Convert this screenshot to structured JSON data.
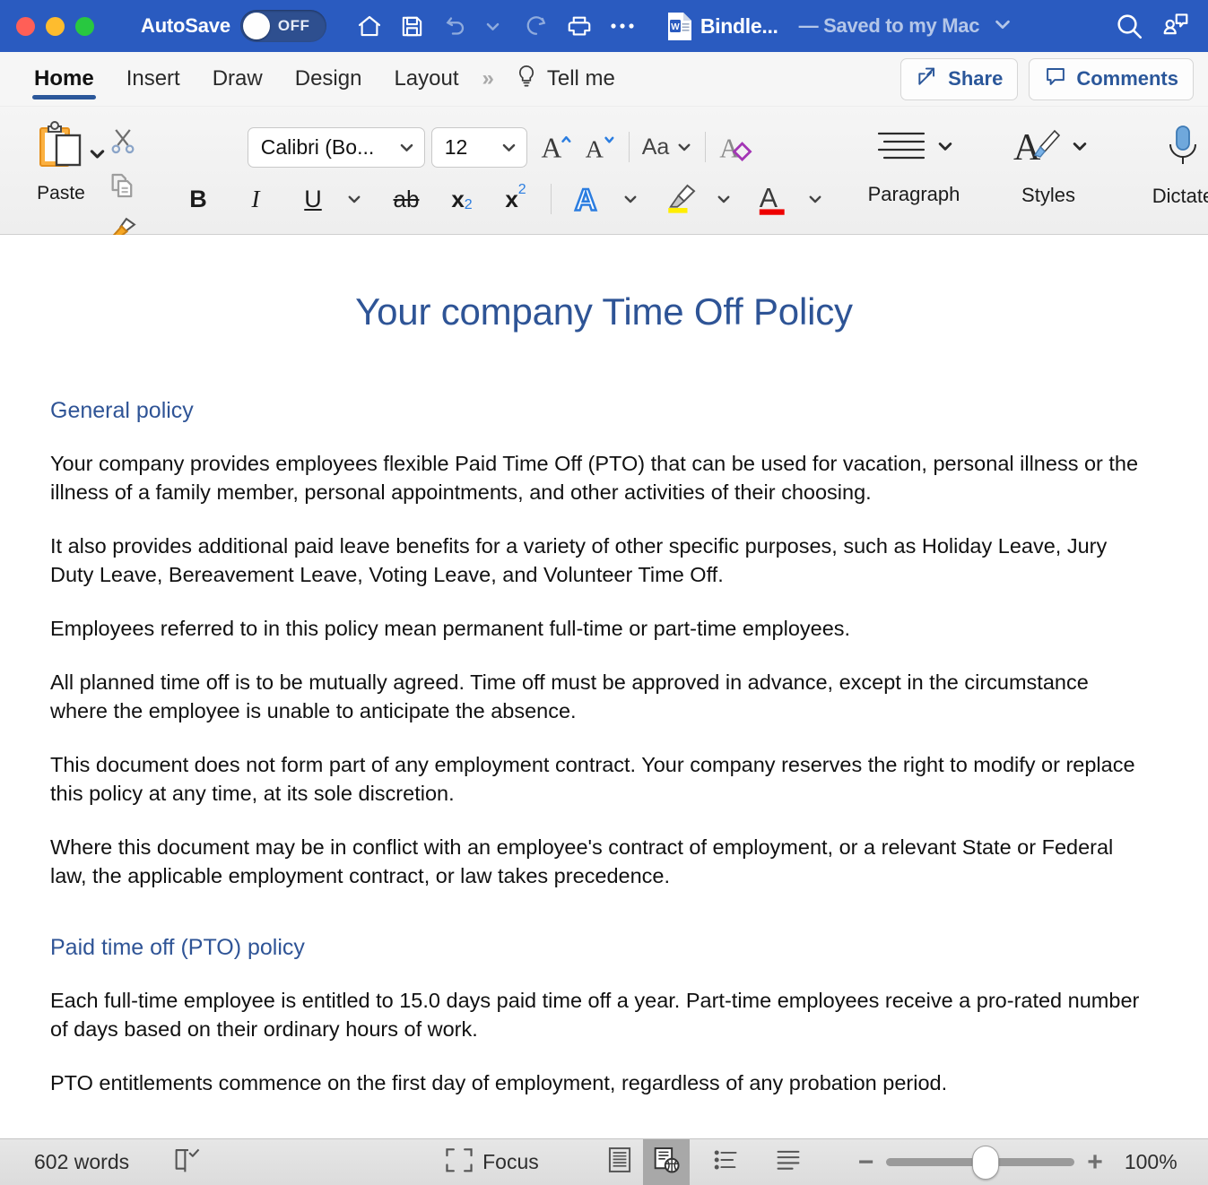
{
  "titlebar": {
    "autosave_label": "AutoSave",
    "autosave_state": "OFF",
    "document_name": "Bindle...",
    "saved_state": "— Saved to my Mac",
    "quick_access": [
      {
        "name": "home-icon",
        "label": "Home"
      },
      {
        "name": "save-icon",
        "label": "Save"
      },
      {
        "name": "undo-icon",
        "label": "Undo"
      },
      {
        "name": "redo-icon",
        "label": "Redo"
      },
      {
        "name": "print-icon",
        "label": "Print"
      },
      {
        "name": "more-icon",
        "label": "More"
      }
    ],
    "search_label": "Search",
    "collaborate_label": "Collaborate"
  },
  "ribbon_tabs": {
    "tabs": [
      {
        "label": "Home",
        "active": true
      },
      {
        "label": "Insert",
        "active": false
      },
      {
        "label": "Draw",
        "active": false
      },
      {
        "label": "Design",
        "active": false
      },
      {
        "label": "Layout",
        "active": false
      }
    ],
    "overflow_label": "»",
    "tellme_label": "Tell me",
    "share_label": "Share",
    "comments_label": "Comments"
  },
  "ribbon": {
    "paste_label": "Paste",
    "cut_label": "Cut",
    "copy_label": "Copy",
    "format_painter_label": "Format Painter",
    "font_name": "Calibri (Bo...",
    "font_size": "12",
    "grow_font_label": "Grow Font",
    "shrink_font_label": "Shrink Font",
    "change_case_label": "Aa",
    "clear_formatting_label": "Clear Formatting",
    "bold_label": "B",
    "italic_label": "I",
    "underline_label": "U",
    "strikethrough_label": "ab",
    "subscript_label": "x",
    "subscript_sub": "2",
    "superscript_label": "x",
    "superscript_sup": "2",
    "text_effects_label": "A",
    "highlight_label": "Text Highlight Color",
    "font_color_label": "A",
    "paragraph_label": "Paragraph",
    "styles_label": "Styles",
    "dictate_label": "Dictate"
  },
  "document": {
    "title": "Your company Time Off Policy",
    "sections": [
      {
        "heading": "General policy",
        "paragraphs": [
          "Your company provides employees flexible Paid Time Off (PTO) that can be used for vacation, personal illness or the illness of a family member, personal appointments, and other activities of their choosing.",
          "It also provides additional paid leave benefits for a variety of other specific purposes, such as Holiday Leave, Jury Duty Leave, Bereavement Leave, Voting Leave, and Volunteer Time Off.",
          "Employees referred to in this policy mean permanent full-time or part-time employees.",
          "All planned time off is to be mutually agreed. Time off must be approved in advance, except in the circumstance where the employee is unable to anticipate the absence.",
          "This document does not form part of any employment contract. Your company reserves the right to modify or replace this policy at any time, at its sole discretion.",
          "Where this document may be in conflict with an employee's contract of employment, or a relevant State or Federal law, the applicable employment contract, or law takes precedence."
        ]
      },
      {
        "heading": "Paid time off (PTO) policy",
        "paragraphs": [
          "Each full-time employee is entitled to 15.0 days paid time off a year. Part-time employees receive a pro-rated number of days based on their ordinary hours of work.",
          "PTO entitlements commence on the first day of employment, regardless of any probation period."
        ]
      }
    ]
  },
  "statusbar": {
    "word_count": "602 words",
    "proofing_label": "Proofing",
    "focus_label": "Focus",
    "print_layout_label": "Print Layout",
    "web_layout_label": "Web Layout",
    "outline_label": "Outline",
    "draft_label": "Draft",
    "zoom_out_label": "−",
    "zoom_in_label": "+",
    "zoom_level": "100%"
  },
  "colors": {
    "titlebar_blue": "#2a5bc0",
    "accent_blue": "#2b579a",
    "heading_blue": "#2f5496",
    "doc_title_blue": "#2e5496"
  }
}
